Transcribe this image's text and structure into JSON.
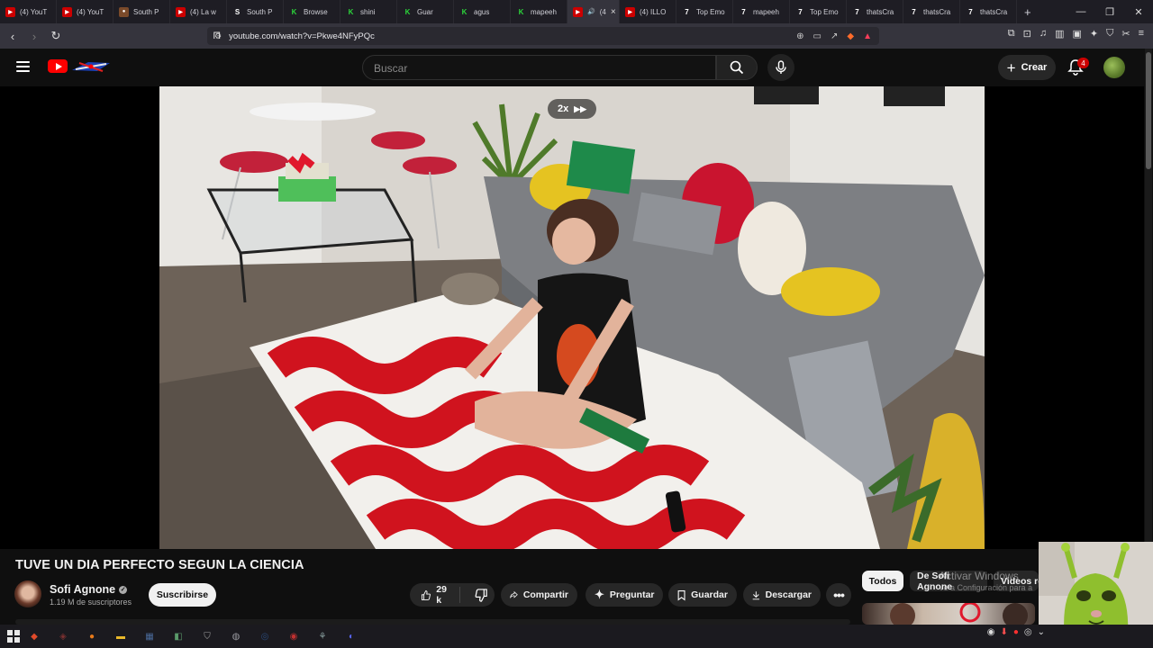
{
  "browser": {
    "tabs": [
      {
        "label": "(4) YouT",
        "fav_color": "#cc0000",
        "fav_glyph": "▶"
      },
      {
        "label": "(4) YouT",
        "fav_color": "#cc0000",
        "fav_glyph": "▶"
      },
      {
        "label": "South P",
        "fav_color": "#7a4a2a",
        "fav_glyph": "●"
      },
      {
        "label": "(4) La w",
        "fav_color": "#cc0000",
        "fav_glyph": "▶"
      },
      {
        "label": "South P",
        "fav_color": "#ffffff",
        "fav_glyph": "S"
      },
      {
        "label": "Browse",
        "fav_color": "#2bd43a",
        "fav_glyph": "K"
      },
      {
        "label": "shini",
        "fav_color": "#2bd43a",
        "fav_glyph": "K"
      },
      {
        "label": "Guar",
        "fav_color": "#2bd43a",
        "fav_glyph": "K"
      },
      {
        "label": "agus",
        "fav_color": "#2bd43a",
        "fav_glyph": "K"
      },
      {
        "label": "mapeeh",
        "fav_color": "#2bd43a",
        "fav_glyph": "K"
      },
      {
        "label": "(4",
        "fav_color": "#cc0000",
        "fav_glyph": "▶",
        "active": true
      },
      {
        "label": "(4) ILLO",
        "fav_color": "#cc0000",
        "fav_glyph": "▶"
      },
      {
        "label": "Top Emo",
        "fav_color": "#ffffff",
        "fav_glyph": "7"
      },
      {
        "label": "mapeeh",
        "fav_color": "#ffffff",
        "fav_glyph": "7"
      },
      {
        "label": "Top Emo",
        "fav_color": "#ffffff",
        "fav_glyph": "7"
      },
      {
        "label": "thatsCra",
        "fav_color": "#ffffff",
        "fav_glyph": "7"
      },
      {
        "label": "thatsCra",
        "fav_color": "#ffffff",
        "fav_glyph": "7"
      },
      {
        "label": "thatsCra",
        "fav_color": "#ffffff",
        "fav_glyph": "7"
      }
    ],
    "url": "youtube.com/watch?v=Pkwe4NFyPQc"
  },
  "youtube": {
    "search_placeholder": "Buscar",
    "create_label": "Crear",
    "notification_count": "4"
  },
  "player": {
    "speed_label": "2x"
  },
  "video": {
    "title": "TUVE UN DIA PERFECTO SEGUN LA CIENCIA",
    "channel_name": "Sofi Agnone",
    "subscribers": "1.19 M de suscriptores",
    "subscribe_label": "Suscribirse",
    "likes": "29 k",
    "share_label": "Compartir",
    "ask_label": "Preguntar",
    "save_label": "Guardar",
    "download_label": "Descargar"
  },
  "recommendations": {
    "chips": [
      "Todos",
      "De Sofi Agnone",
      "Videos re"
    ]
  },
  "watermark": {
    "line1": "Activar Windows",
    "line2": "Ve a Configuración para a"
  },
  "colors": {
    "youtube_red": "#ff0000",
    "background": "#0f0f0f",
    "pill": "#272727"
  }
}
